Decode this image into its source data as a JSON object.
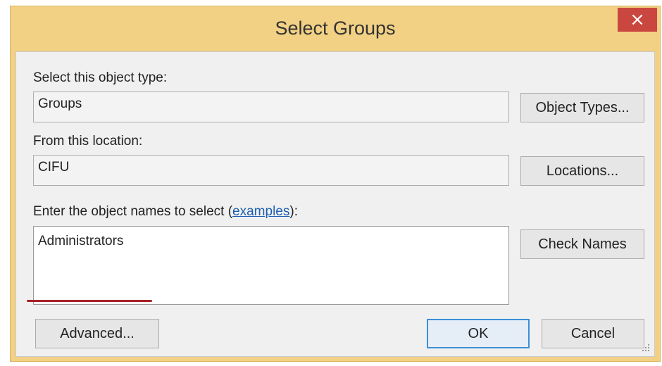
{
  "window": {
    "title": "Select Groups",
    "close_glyph": "×"
  },
  "object_type": {
    "label": "Select this object type:",
    "value": "Groups",
    "button": "Object Types..."
  },
  "location": {
    "label": "From this location:",
    "value": "CIFU",
    "button": "Locations..."
  },
  "names": {
    "label_prefix": "Enter the object names to select (",
    "link": "examples",
    "label_suffix": "):",
    "value": "Administrators",
    "button": "Check Names"
  },
  "footer": {
    "advanced": "Advanced...",
    "ok": "OK",
    "cancel": "Cancel"
  },
  "colors": {
    "title_bar": "#f2d184",
    "close_button": "#c9473e",
    "annotation": "#a72127"
  }
}
